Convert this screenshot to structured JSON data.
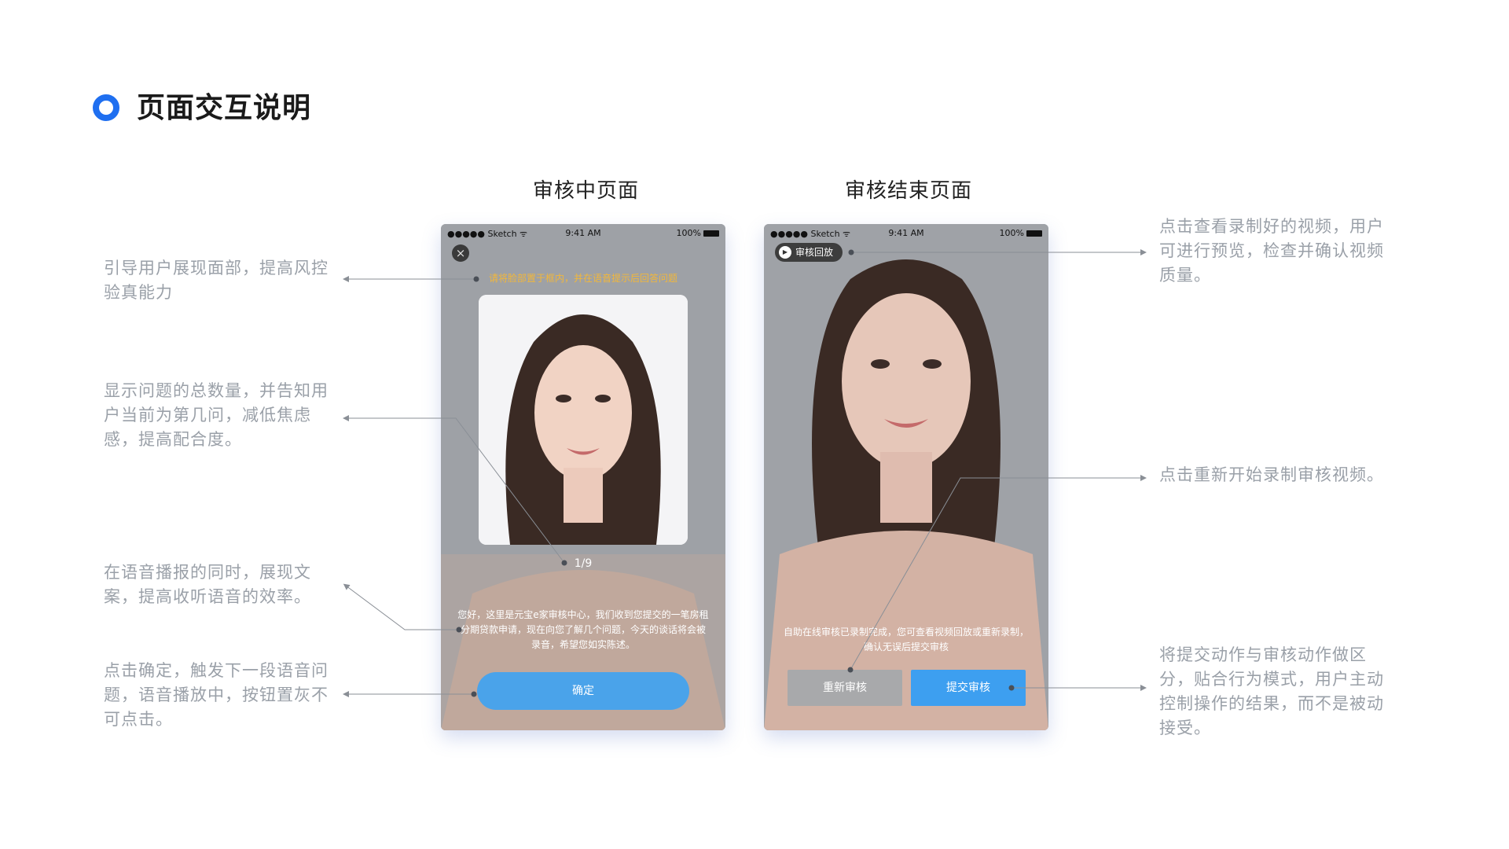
{
  "header": {
    "title": "页面交互说明"
  },
  "sections": {
    "reviewing_title": "审核中页面",
    "ended_title": "审核结束页面"
  },
  "status_bar": {
    "carrier": "●●●●● Sketch ᯤ",
    "time": "9:41 AM",
    "battery": "100%"
  },
  "reviewing": {
    "close_icon": "×",
    "hint": "请将脸部置于框内，并在语音提示后回答问题",
    "counter": "1/9",
    "prompt": "您好，这里是元宝e家审核中心，我们收到您提交的一笔房租分期贷款申请，现在向您了解几个问题，今天的谈话将会被录音，希望您如实陈述。",
    "confirm_label": "确定"
  },
  "ended": {
    "replay_label": "审核回放",
    "play_icon": "▶",
    "prompt": "自助在线审核已录制完成，您可查看视频回放或重新录制，确认无误后提交审核",
    "redo_label": "重新审核",
    "submit_label": "提交审核"
  },
  "notes": {
    "left": [
      "引导用户展现面部，提高风控验真能力",
      "显示问题的总数量，并告知用户当前为第几问，减低焦虑感，提高配合度。",
      "在语音播报的同时，展现文案，提高收听语音的效率。",
      "点击确定，触发下一段语音问题，语音播放中，按钮置灰不可点击。"
    ],
    "right": [
      "点击查看录制好的视频，用户可进行预览，检查并确认视频质量。",
      "点击重新开始录制审核视频。",
      "将提交动作与审核动作做区分，贴合行为模式，用户主动控制操作的结果，而不是被动接受。"
    ]
  },
  "colors": {
    "accent": "#1f6ff0",
    "note_text": "#9aa0a8",
    "button_blue": "#4aa3ea",
    "hint_yellow": "#f2b73a"
  }
}
